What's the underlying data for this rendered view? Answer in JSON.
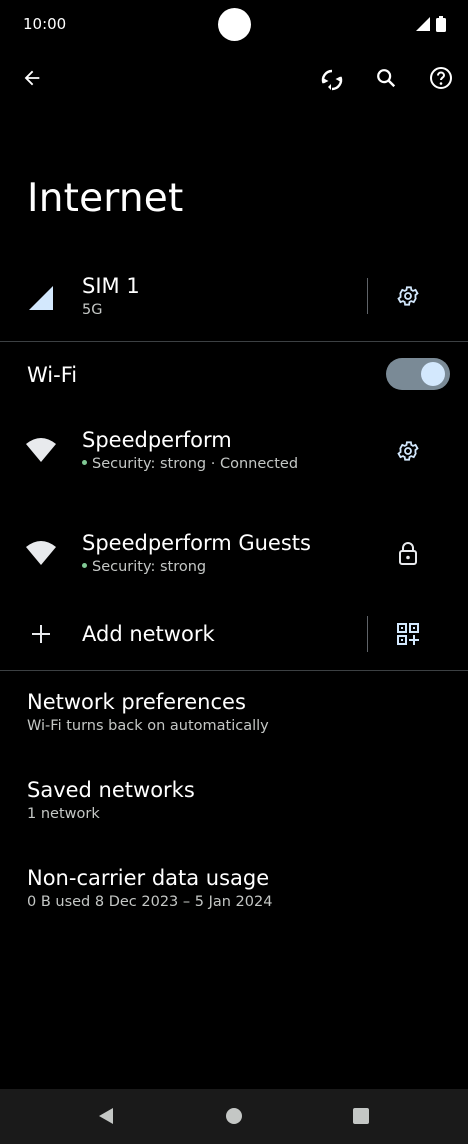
{
  "status": {
    "time": "10:00"
  },
  "title": "Internet",
  "sim": {
    "name": "SIM 1",
    "network": "5G"
  },
  "wifi": {
    "label": "Wi-Fi",
    "enabled": true
  },
  "networks": [
    {
      "name": "Speedperform",
      "status": "Security: strong · Connected"
    },
    {
      "name": "Speedperform Guests",
      "status": "Security: strong"
    }
  ],
  "add_network": "Add network",
  "settings_list": [
    {
      "title": "Network preferences",
      "subtitle": "Wi-Fi turns back on automatically"
    },
    {
      "title": "Saved networks",
      "subtitle": "1 network"
    },
    {
      "title": "Non-carrier data usage",
      "subtitle": "0 B used 8 Dec 2023 – 5 Jan 2024"
    }
  ],
  "colors": {
    "background": "#000000",
    "accent": "#d3e8fd",
    "connected_dot": "#81c995"
  }
}
